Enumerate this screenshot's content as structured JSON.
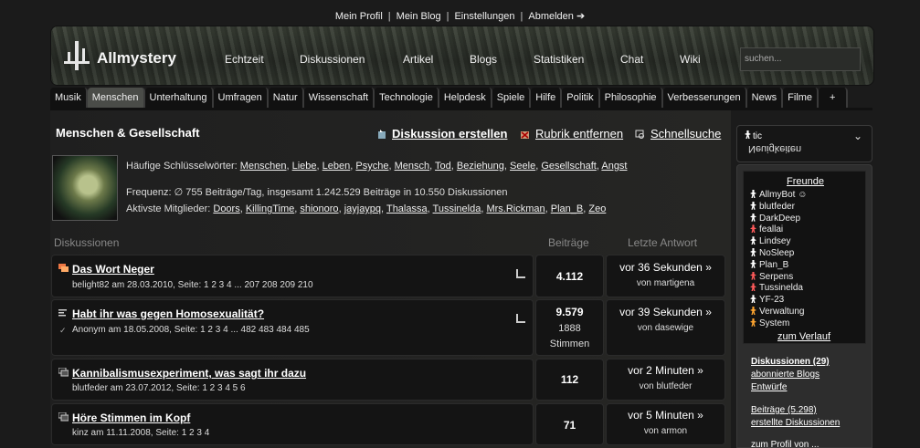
{
  "toplinks": {
    "profile": "Mein Profil",
    "blog": "Mein Blog",
    "settings": "Einstellungen",
    "logout": "Abmelden ➔"
  },
  "header": {
    "logo": "Allmystery",
    "nav": [
      "Echtzeit",
      "Diskussionen",
      "Artikel",
      "Blogs",
      "Statistiken",
      "Chat",
      "Wiki"
    ],
    "search_placeholder": "suchen..."
  },
  "categories": [
    "Musik",
    "Menschen",
    "Unterhaltung",
    "Umfragen",
    "Natur",
    "Wissenschaft",
    "Technologie",
    "Helpdesk",
    "Spiele",
    "Hilfe",
    "Politik",
    "Philosophie",
    "Verbesserungen",
    "News",
    "Filme",
    "+"
  ],
  "active_category": "Menschen",
  "page": {
    "title": "Menschen & Gesellschaft",
    "actions": {
      "create": "Diskussion erstellen",
      "remove": "Rubrik entfernen",
      "quicksearch": "Schnellsuche"
    },
    "keywords_label": "Häufige Schlüsselwörter:",
    "keywords": [
      "Menschen",
      "Liebe",
      "Leben",
      "Psyche",
      "Mensch",
      "Tod",
      "Beziehung",
      "Seele",
      "Gesellschaft",
      "Angst"
    ],
    "frequency": "Frequenz: ∅ 755 Beiträge/Tag, insgesamt 1.242.529 Beiträge in 10.550 Diskussionen",
    "members_label": "Aktivste Mitglieder:",
    "members": [
      "Doors",
      "KillingTime",
      "shionoro",
      "jayjaypq",
      "Thalassa",
      "Tussinelda",
      "Mrs.Rickman",
      "Plan_B",
      "Zeo"
    ]
  },
  "columns": {
    "discussions": "Diskussionen",
    "posts": "Beiträge",
    "last": "Letzte Antwort"
  },
  "threads": [
    {
      "title": "Das Wort Neger",
      "meta": "belight82 am 28.03.2010, Seite: 1 2 3 4 ... 207 208 209 210",
      "posts": "4.112",
      "votes": "",
      "votes_label": "",
      "last": "vor 36 Sekunden »",
      "last_by": "von martigena"
    },
    {
      "title": "Habt ihr was gegen Homosexualität?",
      "meta": "Anonym am 18.05.2008, Seite: 1 2 3 4 ... 482 483 484 485",
      "posts": "9.579",
      "votes": "1888",
      "votes_label": "Stimmen",
      "last": "vor 39 Sekunden »",
      "last_by": "von dasewige"
    },
    {
      "title": "Kannibalismusexperiment, was sagt ihr dazu",
      "meta": "blutfeder am 23.07.2012, Seite: 1 2 3 4 5 6",
      "posts": "112",
      "votes": "",
      "votes_label": "",
      "last": "vor 2 Minuten »",
      "last_by": "von blutfeder"
    },
    {
      "title": "Höre Stimmen im Kopf",
      "meta": "kinz am 11.11.2008, Seite: 1 2 3 4",
      "posts": "71",
      "votes": "",
      "votes_label": "",
      "last": "vor 5 Minuten »",
      "last_by": "von armon"
    }
  ],
  "sidebar": {
    "user": "tic",
    "user_mirror": "Neuigkeiten",
    "friends_title": "Freunde",
    "friends": [
      {
        "name": "AllmyBot ☺",
        "color": "#ffffff"
      },
      {
        "name": "blutfeder",
        "color": "#ffffff"
      },
      {
        "name": "DarkDeep",
        "color": "#ffffff"
      },
      {
        "name": "feallai",
        "color": "#ff5a5a"
      },
      {
        "name": "Lindsey",
        "color": "#ffffff"
      },
      {
        "name": "NoSleep",
        "color": "#ffffff"
      },
      {
        "name": "Plan_B",
        "color": "#ffffff"
      },
      {
        "name": "Serpens",
        "color": "#ff5a5a"
      },
      {
        "name": "Tussinelda",
        "color": "#ff5a5a"
      },
      {
        "name": "YF-23",
        "color": "#ffffff"
      },
      {
        "name": "Verwaltung",
        "color": "#ffa530"
      },
      {
        "name": "System",
        "color": "#ffa530"
      }
    ],
    "history": "zum Verlauf",
    "links": [
      "Diskussionen (29)",
      "abonnierte Blogs",
      "Entwürfe",
      "Beiträge (5.298)",
      "erstellte Diskussionen",
      "zum Profil von ..."
    ]
  }
}
